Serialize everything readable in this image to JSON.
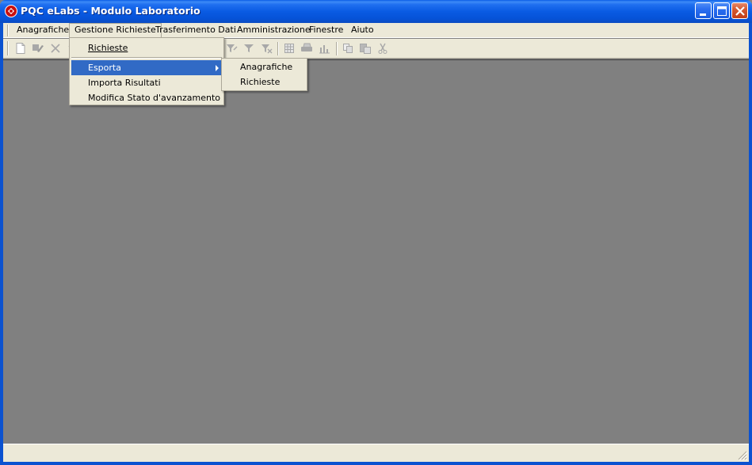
{
  "window": {
    "title": "PQC eLabs - Modulo Laboratorio"
  },
  "menubar": {
    "items": [
      {
        "label": "Anagrafiche"
      },
      {
        "label": "Gestione Richieste"
      },
      {
        "label": "Trasferimento Dati"
      },
      {
        "label": "Amministrazione"
      },
      {
        "label": "Finestre"
      },
      {
        "label": "Aiuto"
      }
    ]
  },
  "gestione_menu": {
    "items": [
      {
        "label": "Richieste"
      },
      {
        "label": "Esporta"
      },
      {
        "label": "Importa Risultati"
      },
      {
        "label": "Modifica Stato d'avanzamento"
      }
    ]
  },
  "esporta_submenu": {
    "items": [
      {
        "label": "Anagrafiche"
      },
      {
        "label": "Richieste"
      }
    ]
  },
  "toolbar": {
    "icons": [
      "new-icon",
      "edit-icon",
      "delete-icon",
      "filter-icon",
      "filter-apply-icon",
      "filter-remove-icon",
      "grid-icon",
      "print-icon",
      "chart-icon",
      "copy-icon",
      "paste-icon",
      "cut-icon"
    ]
  },
  "colors": {
    "menu_bg": "#ece9d8",
    "highlight": "#316ac5",
    "client_bg": "#808080",
    "titlebar": "#0a5be3"
  }
}
